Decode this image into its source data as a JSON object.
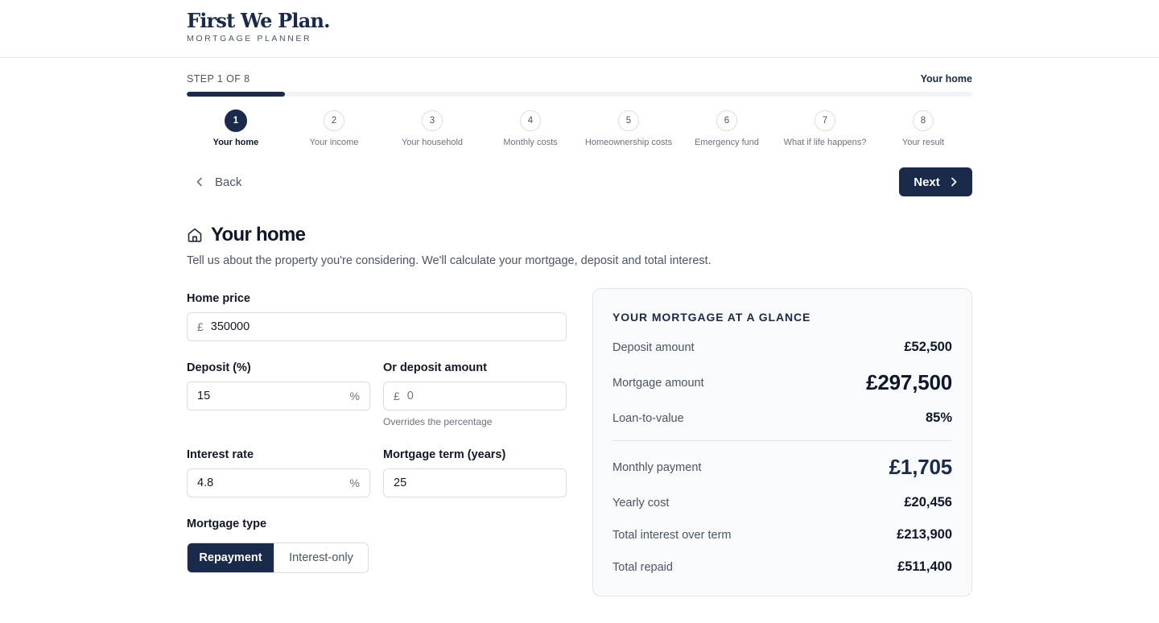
{
  "header": {
    "brand": "First We Plan.",
    "subtitle": "MORTGAGE PLANNER"
  },
  "progress": {
    "step_text": "STEP 1 OF 8",
    "current_name": "Your home",
    "fraction": 0.125
  },
  "steps": [
    {
      "num": "1",
      "label": "Your home"
    },
    {
      "num": "2",
      "label": "Your income"
    },
    {
      "num": "3",
      "label": "Your household"
    },
    {
      "num": "4",
      "label": "Monthly costs"
    },
    {
      "num": "5",
      "label": "Homeownership costs"
    },
    {
      "num": "6",
      "label": "Emergency fund"
    },
    {
      "num": "7",
      "label": "What if life happens?"
    },
    {
      "num": "8",
      "label": "Your result"
    }
  ],
  "nav": {
    "back_label": "Back",
    "next_label": "Next"
  },
  "section": {
    "icon": "home-icon",
    "title": "Your home",
    "description": "Tell us about the property you're considering. We'll calculate your mortgage, deposit and total interest."
  },
  "form": {
    "home_price": {
      "label": "Home price",
      "prefix": "£",
      "value": "350000"
    },
    "deposit_pct": {
      "label": "Deposit (%)",
      "value": "15",
      "suffix": "%"
    },
    "deposit_amount": {
      "label": "Or deposit amount",
      "prefix": "£",
      "placeholder": "0",
      "hint": "Overrides the percentage"
    },
    "interest_rate": {
      "label": "Interest rate",
      "value": "4.8",
      "suffix": "%"
    },
    "term": {
      "label": "Mortgage term (years)",
      "value": "25"
    },
    "mortgage_type": {
      "label": "Mortgage type",
      "options": [
        "Repayment",
        "Interest-only"
      ],
      "selected": "Repayment"
    }
  },
  "summary": {
    "title": "YOUR MORTGAGE AT A GLANCE",
    "deposit": {
      "label": "Deposit amount",
      "value": "£52,500"
    },
    "mortgage": {
      "label": "Mortgage amount",
      "value": "£297,500"
    },
    "ltv": {
      "label": "Loan-to-value",
      "value": "85%"
    },
    "monthly": {
      "label": "Monthly payment",
      "value": "£1,705"
    },
    "yearly": {
      "label": "Yearly cost",
      "value": "£20,456"
    },
    "interest": {
      "label": "Total interest over term",
      "value": "£213,900"
    },
    "repaid": {
      "label": "Total repaid",
      "value": "£511,400"
    }
  },
  "colors": {
    "brand": "#1a2a4a",
    "muted_text": "#4b5563",
    "border": "#d9dde3",
    "panel_bg": "#f8fafc"
  }
}
